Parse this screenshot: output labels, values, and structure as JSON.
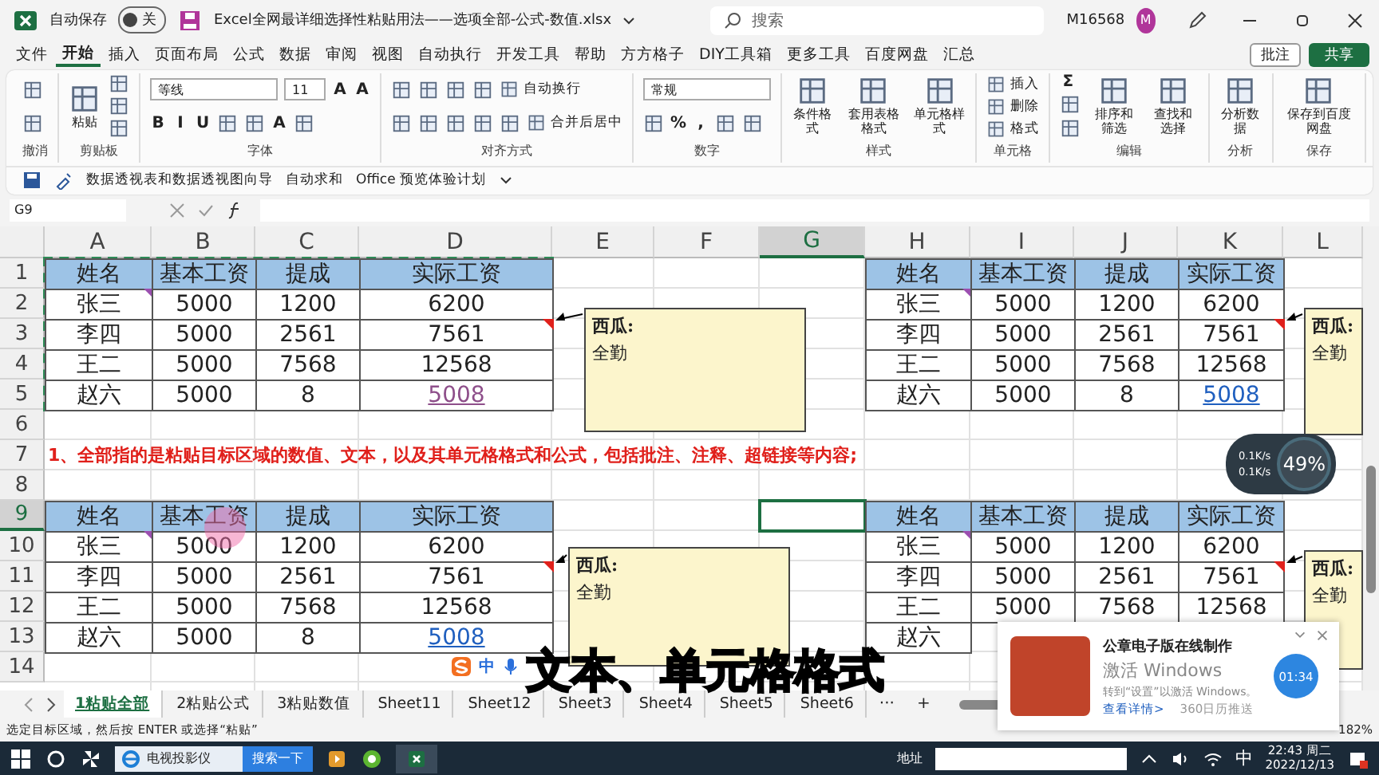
{
  "title_bar": {
    "autosave_label": "自动保存",
    "autosave": {
      "on": false,
      "label": "关"
    },
    "file_name": "Excel全网最详细选择性粘贴用法——选项全部-公式-数值.xlsx",
    "search_placeholder": "搜索",
    "user": "M16568",
    "avatar": "M"
  },
  "menu": {
    "tabs": [
      {
        "label": "文件",
        "selected": false
      },
      {
        "label": "开始",
        "selected": true
      },
      {
        "label": "插入",
        "selected": false
      },
      {
        "label": "页面布局",
        "selected": false
      },
      {
        "label": "公式",
        "selected": false
      },
      {
        "label": "数据",
        "selected": false
      },
      {
        "label": "审阅",
        "selected": false
      },
      {
        "label": "视图",
        "selected": false
      },
      {
        "label": "自动执行",
        "selected": false
      },
      {
        "label": "开发工具",
        "selected": false
      },
      {
        "label": "帮助",
        "selected": false
      },
      {
        "label": "方方格子",
        "selected": false
      },
      {
        "label": "DIY工具箱",
        "selected": false
      },
      {
        "label": "更多工具",
        "selected": false
      },
      {
        "label": "百度网盘",
        "selected": false
      },
      {
        "label": "汇总",
        "selected": false
      }
    ],
    "comment_button": "批注",
    "share_button": "共享"
  },
  "ribbon": {
    "groups": [
      {
        "label": "撤消",
        "items": [
          {
            "kind": "stack",
            "lines": [
              {
                "items": [
                  {
                    "kind": "icon"
                  }
                ]
              },
              {
                "items": [
                  {
                    "kind": "icon"
                  }
                ]
              }
            ]
          }
        ]
      },
      {
        "label": "剪贴板",
        "items": [
          {
            "kind": "large",
            "label": "粘贴"
          },
          {
            "kind": "stack",
            "lines": [
              {
                "items": [
                  {
                    "kind": "icon"
                  }
                ]
              },
              {
                "items": [
                  {
                    "kind": "icon"
                  }
                ]
              },
              {
                "items": [
                  {
                    "kind": "icon"
                  }
                ]
              }
            ]
          }
        ]
      },
      {
        "label": "字体",
        "items": [
          {
            "kind": "stack",
            "lines": [
              {
                "items": [
                  {
                    "kind": "field",
                    "label": "等线"
                  },
                  {
                    "kind": "field",
                    "label": "11"
                  },
                  {
                    "kind": "glyph",
                    "label": "A"
                  },
                  {
                    "kind": "glyph",
                    "label": "A"
                  }
                ]
              },
              {
                "items": [
                  {
                    "kind": "glyph",
                    "label": "B"
                  },
                  {
                    "kind": "glyph",
                    "label": "I"
                  },
                  {
                    "kind": "glyph",
                    "label": "U"
                  },
                  {
                    "kind": "icon"
                  },
                  {
                    "kind": "icon"
                  },
                  {
                    "kind": "glyph",
                    "label": "A"
                  },
                  {
                    "kind": "icon"
                  }
                ]
              }
            ]
          }
        ]
      },
      {
        "label": "对齐方式",
        "items": [
          {
            "kind": "stack",
            "lines": [
              {
                "items": [
                  {
                    "kind": "icon"
                  },
                  {
                    "kind": "icon"
                  },
                  {
                    "kind": "icon"
                  },
                  {
                    "kind": "icon"
                  },
                  {
                    "kind": "small",
                    "label": "自动换行"
                  }
                ]
              },
              {
                "items": [
                  {
                    "kind": "icon"
                  },
                  {
                    "kind": "icon"
                  },
                  {
                    "kind": "icon"
                  },
                  {
                    "kind": "icon"
                  },
                  {
                    "kind": "icon"
                  },
                  {
                    "kind": "small",
                    "label": "合并后居中"
                  }
                ]
              }
            ]
          }
        ]
      },
      {
        "label": "数字",
        "items": [
          {
            "kind": "stack",
            "lines": [
              {
                "items": [
                  {
                    "kind": "field",
                    "label": "常规"
                  }
                ]
              },
              {
                "items": [
                  {
                    "kind": "icon"
                  },
                  {
                    "kind": "glyph",
                    "label": "%"
                  },
                  {
                    "kind": "glyph",
                    "label": ","
                  },
                  {
                    "kind": "icon"
                  },
                  {
                    "kind": "icon"
                  }
                ]
              }
            ]
          }
        ]
      },
      {
        "label": "样式",
        "items": [
          {
            "kind": "large",
            "label": "条件格式"
          },
          {
            "kind": "large",
            "label": "套用表格格式"
          },
          {
            "kind": "large",
            "label": "单元格样式"
          }
        ]
      },
      {
        "label": "单元格",
        "items": [
          {
            "kind": "stack",
            "lines": [
              {
                "items": [
                  {
                    "kind": "small",
                    "label": "插入"
                  }
                ]
              },
              {
                "items": [
                  {
                    "kind": "small",
                    "label": "删除"
                  }
                ]
              },
              {
                "items": [
                  {
                    "kind": "small",
                    "label": "格式"
                  }
                ]
              }
            ]
          }
        ]
      },
      {
        "label": "编辑",
        "items": [
          {
            "kind": "stack",
            "lines": [
              {
                "items": [
                  {
                    "kind": "glyph",
                    "label": "Σ"
                  }
                ]
              },
              {
                "items": [
                  {
                    "kind": "icon"
                  }
                ]
              },
              {
                "items": [
                  {
                    "kind": "icon"
                  }
                ]
              }
            ]
          },
          {
            "kind": "large",
            "label": "排序和筛选"
          },
          {
            "kind": "large",
            "label": "查找和选择"
          }
        ]
      },
      {
        "label": "分析",
        "items": [
          {
            "kind": "large",
            "label": "分析数据"
          }
        ]
      },
      {
        "label": "保存",
        "items": [
          {
            "kind": "large",
            "label": "保存到百度网盘"
          }
        ]
      }
    ]
  },
  "quick_access": [
    "数据透视表和数据透视图向导",
    "自动求和",
    "Office 预览体验计划"
  ],
  "formula_bar": {
    "name_box": "G9"
  },
  "grid": {
    "copy_marquee": true,
    "columns": [
      {
        "label": "A",
        "selected": false
      },
      {
        "label": "B",
        "selected": false
      },
      {
        "label": "C",
        "selected": false
      },
      {
        "label": "D",
        "selected": false
      },
      {
        "label": "E",
        "selected": false
      },
      {
        "label": "F",
        "selected": false
      },
      {
        "label": "G",
        "selected": true
      },
      {
        "label": "H",
        "selected": false
      },
      {
        "label": "I",
        "selected": false
      },
      {
        "label": "J",
        "selected": false
      },
      {
        "label": "K",
        "selected": false
      },
      {
        "label": "L",
        "selected": false
      }
    ],
    "rows": [
      {
        "label": "1",
        "selected": false
      },
      {
        "label": "2",
        "selected": false
      },
      {
        "label": "3",
        "selected": false
      },
      {
        "label": "4",
        "selected": false
      },
      {
        "label": "5",
        "selected": false
      },
      {
        "label": "6",
        "selected": false
      },
      {
        "label": "7",
        "selected": false
      },
      {
        "label": "8",
        "selected": false
      },
      {
        "label": "9",
        "selected": true
      },
      {
        "label": "10",
        "selected": false
      },
      {
        "label": "11",
        "selected": false
      },
      {
        "label": "12",
        "selected": false
      },
      {
        "label": "13",
        "selected": false
      },
      {
        "label": "14",
        "selected": false
      }
    ],
    "note": "1、全部指的是粘贴目标区域的数值、文本，以及其单元格格式和公式，包括批注、注释、超链接等内容;",
    "tables": [
      {
        "header": [
          "姓名",
          "基本工资",
          "提成",
          "实际工资"
        ],
        "rows": [
          {
            "cells": [
              "张三",
              "5000",
              "1200",
              "6200"
            ],
            "flag": true,
            "comment": false,
            "link": false,
            "visited": false
          },
          {
            "cells": [
              "李四",
              "5000",
              "2561",
              "7561"
            ],
            "flag": false,
            "comment": true,
            "link": false,
            "visited": false
          },
          {
            "cells": [
              "王二",
              "5000",
              "7568",
              "12568"
            ],
            "flag": false,
            "comment": false,
            "link": false,
            "visited": false
          },
          {
            "cells": [
              "赵六",
              "5000",
              "8",
              "5008"
            ],
            "flag": false,
            "comment": false,
            "link": true,
            "visited": true
          }
        ]
      },
      {
        "header": [
          "姓名",
          "基本工资",
          "提成",
          "实际工资"
        ],
        "rows": [
          {
            "cells": [
              "张三",
              "5000",
              "1200",
              "6200"
            ],
            "flag": true,
            "comment": false,
            "link": false,
            "visited": false
          },
          {
            "cells": [
              "李四",
              "5000",
              "2561",
              "7561"
            ],
            "flag": false,
            "comment": true,
            "link": false,
            "visited": false
          },
          {
            "cells": [
              "王二",
              "5000",
              "7568",
              "12568"
            ],
            "flag": false,
            "comment": false,
            "link": false,
            "visited": false
          },
          {
            "cells": [
              "赵六",
              "5000",
              "8",
              "5008"
            ],
            "flag": false,
            "comment": false,
            "link": true,
            "visited": false
          }
        ]
      },
      {
        "header": [
          "姓名",
          "基本工资",
          "提成",
          "实际工资"
        ],
        "rows": [
          {
            "cells": [
              "张三",
              "5000",
              "1200",
              "6200"
            ],
            "flag": true,
            "comment": false,
            "link": false,
            "visited": false
          },
          {
            "cells": [
              "李四",
              "5000",
              "2561",
              "7561"
            ],
            "flag": false,
            "comment": true,
            "link": false,
            "visited": false
          },
          {
            "cells": [
              "王二",
              "5000",
              "7568",
              "12568"
            ],
            "flag": false,
            "comment": false,
            "link": false,
            "visited": false
          },
          {
            "cells": [
              "赵六",
              "5000",
              "8",
              "5008"
            ],
            "flag": false,
            "comment": false,
            "link": true,
            "visited": false
          }
        ]
      },
      {
        "header": [
          "姓名",
          "基本工资",
          "提成",
          "实际工资"
        ],
        "rows": [
          {
            "cells": [
              "张三",
              "5000",
              "1200",
              "6200"
            ],
            "flag": true,
            "comment": false,
            "link": false,
            "visited": false
          },
          {
            "cells": [
              "李四",
              "5000",
              "2561",
              "7561"
            ],
            "flag": false,
            "comment": true,
            "link": false,
            "visited": false
          },
          {
            "cells": [
              "王二",
              "5000",
              "7568",
              "12568"
            ],
            "flag": false,
            "comment": false,
            "link": false,
            "visited": false
          },
          {
            "cells": [
              "赵六"
            ],
            "flag": false,
            "comment": false,
            "link": false,
            "visited": false
          }
        ]
      }
    ]
  },
  "comments": [
    {
      "author": "西瓜:",
      "text": "全勤"
    },
    {
      "author": "西瓜:",
      "text": "全勤"
    },
    {
      "author": "西瓜:",
      "text": "全勤"
    },
    {
      "author": "西瓜:",
      "text": "全勤"
    }
  ],
  "sheet_tabs": {
    "tabs": [
      {
        "label": "1粘贴全部",
        "selected": true
      },
      {
        "label": "2粘贴公式",
        "selected": false
      },
      {
        "label": "3粘贴数值",
        "selected": false
      },
      {
        "label": "Sheet11",
        "selected": false
      },
      {
        "label": "Sheet12",
        "selected": false
      },
      {
        "label": "Sheet3",
        "selected": false
      },
      {
        "label": "Sheet4",
        "selected": false
      },
      {
        "label": "Sheet5",
        "selected": false
      },
      {
        "label": "Sheet6",
        "selected": false
      }
    ],
    "more": "···",
    "add": "+"
  },
  "status_bar": {
    "message": "选定目标区域，然后按 ENTER 或选择“粘贴”",
    "zoom": "182%"
  },
  "subtitle": "文本、单元格格式",
  "ime_bar": {
    "mode": "中"
  },
  "speed_widget": {
    "upload": "0.1K/s",
    "download": "0.1K/s",
    "percent": "49%"
  },
  "timer": "01:34",
  "popup": {
    "title": "公章电子版在线制作",
    "watermark_title": "激活 Windows",
    "watermark_text": "转到“设置”以激活 Windows。",
    "link": "查看详情>",
    "source": "360日历推送"
  },
  "taskbar": {
    "search_value": "电视投影仪",
    "search_button": "搜索一下",
    "address_label": "地址",
    "ime": "中",
    "time": "22:43 周二",
    "date": "2022/12/13"
  }
}
